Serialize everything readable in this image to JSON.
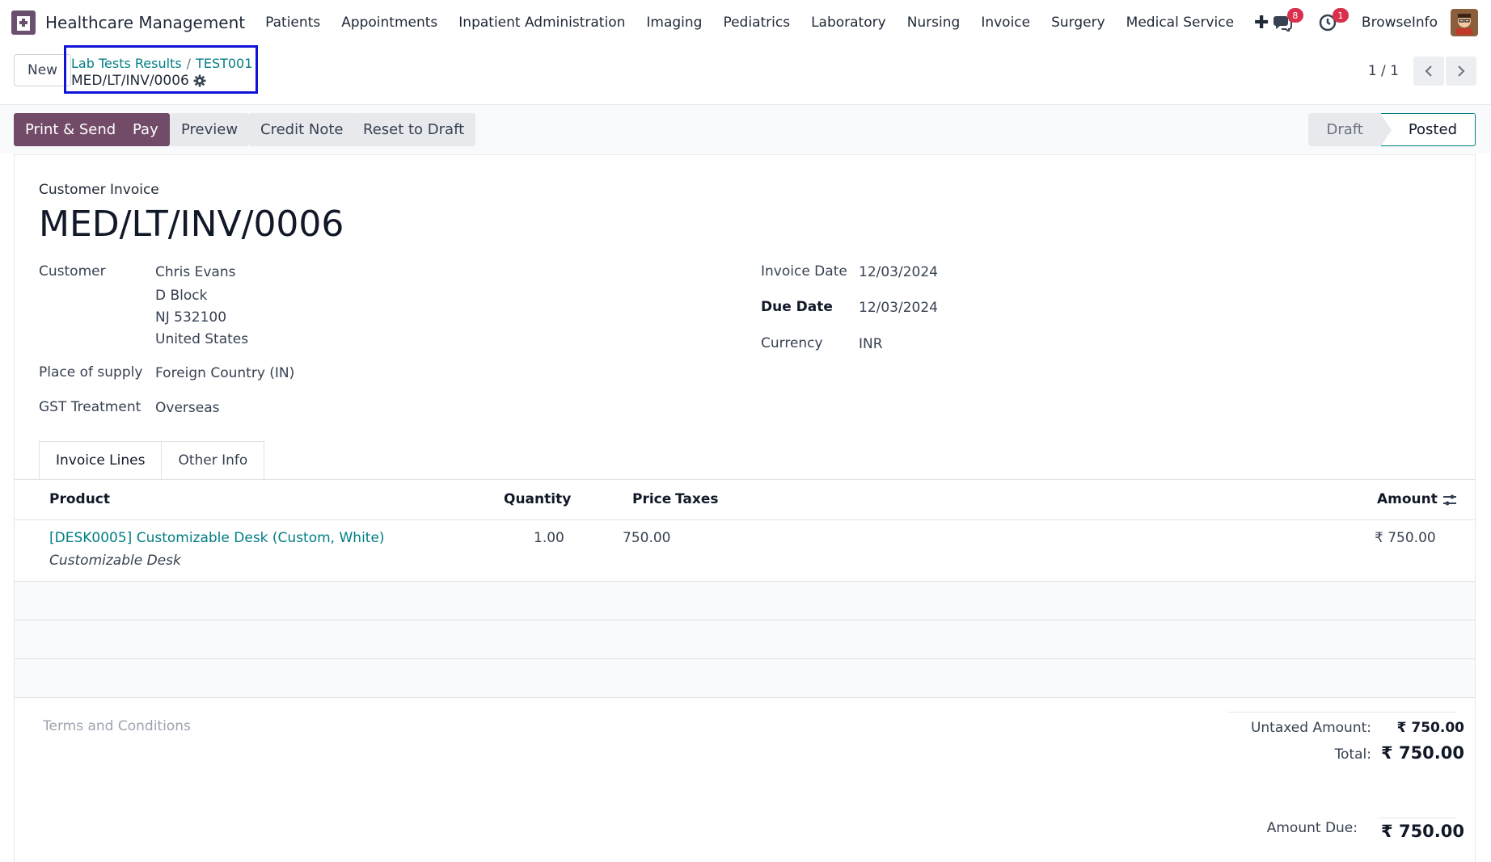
{
  "app": {
    "title": "Healthcare Management",
    "menu": [
      "Patients",
      "Appointments",
      "Inpatient Administration",
      "Imaging",
      "Pediatrics",
      "Laboratory",
      "Nursing",
      "Invoice",
      "Surgery",
      "Medical Service"
    ],
    "plus_label": "✚",
    "messages_count": "8",
    "activities_count": "1",
    "company": "BrowseInfo"
  },
  "control": {
    "new_label": "New",
    "breadcrumb": [
      "Lab Tests Results",
      "TEST001"
    ],
    "breadcrumb_sep": "/",
    "record_name": "MED/LT/INV/0006",
    "pager": "1 / 1"
  },
  "actions": {
    "print_send": "Print & Send",
    "pay": "Pay",
    "preview": "Preview",
    "credit_note": "Credit Note",
    "reset_draft": "Reset to Draft"
  },
  "status": {
    "draft": "Draft",
    "posted": "Posted"
  },
  "invoice": {
    "type": "Customer Invoice",
    "number": "MED/LT/INV/0006",
    "customer_label": "Customer",
    "customer_name": "Chris Evans",
    "address": [
      "D Block",
      "NJ 532100",
      "United States"
    ],
    "place_label": "Place of supply",
    "place_value": "Foreign Country (IN)",
    "gst_label": "GST Treatment",
    "gst_value": "Overseas",
    "invoice_date_label": "Invoice Date",
    "invoice_date": "12/03/2024",
    "due_date_label": "Due Date",
    "due_date": "12/03/2024",
    "currency_label": "Currency",
    "currency": "INR"
  },
  "tabs": [
    "Invoice Lines",
    "Other Info"
  ],
  "lines": {
    "headers": {
      "product": "Product",
      "quantity": "Quantity",
      "price": "Price",
      "taxes": "Taxes",
      "amount": "Amount"
    },
    "rows": [
      {
        "product": "[DESK0005] Customizable Desk (Custom, White)",
        "description": "Customizable Desk",
        "quantity": "1.00",
        "price": "750.00",
        "taxes": "",
        "amount": "₹ 750.00"
      }
    ]
  },
  "footer": {
    "terms_placeholder": "Terms and Conditions",
    "untaxed_label": "Untaxed Amount:",
    "untaxed_value": "₹ 750.00",
    "total_label": "Total:",
    "total_value": "₹ 750.00",
    "due_label": "Amount Due:",
    "due_value": "₹ 750.00"
  },
  "colors": {
    "primary": "#714b67",
    "link": "#017e84",
    "badge": "#d9304e",
    "highlight_box": "#1014d6"
  }
}
